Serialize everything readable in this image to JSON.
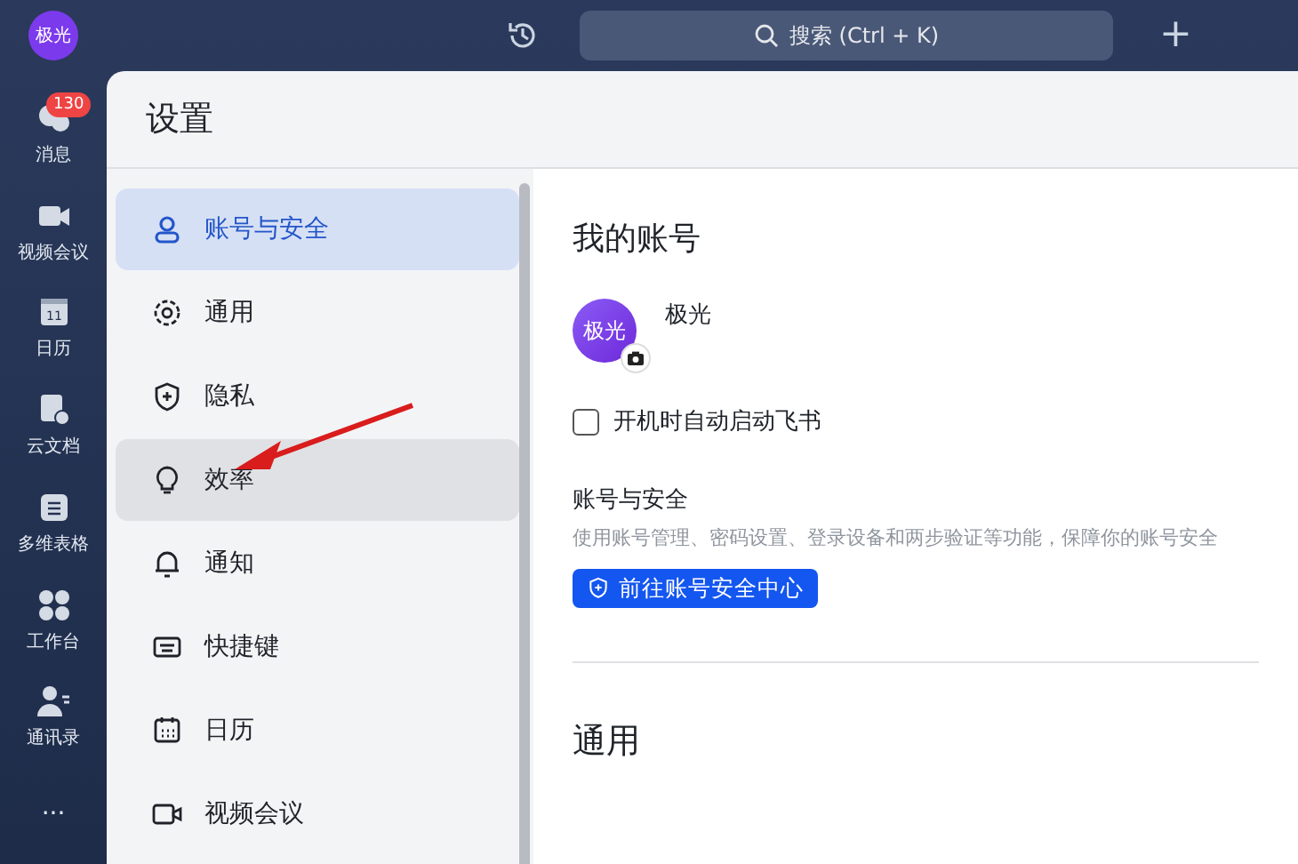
{
  "top_bar": {
    "avatar": "极光",
    "search_placeholder": "搜索 (Ctrl + K)",
    "add": "+"
  },
  "rail": [
    {
      "label": "消息",
      "badge": "130",
      "selected": false
    },
    {
      "label": "视频会议",
      "selected": false
    },
    {
      "label": "日历",
      "icon_text": "11",
      "selected": false
    },
    {
      "label": "云文档",
      "selected": false
    },
    {
      "label": "多维表格",
      "selected": false
    },
    {
      "label": "工作台",
      "selected": false
    },
    {
      "label": "通讯录",
      "selected": false
    },
    {
      "label": "···",
      "selected": false
    }
  ],
  "settings": {
    "title": "设置",
    "menu": [
      {
        "label": "账号与安全",
        "selected": true,
        "highlighted": false
      },
      {
        "label": "通用",
        "selected": false,
        "highlighted": false
      },
      {
        "label": "隐私",
        "selected": false,
        "highlighted": false
      },
      {
        "label": "效率",
        "selected": false,
        "highlighted": true
      },
      {
        "label": "通知",
        "selected": false,
        "highlighted": false
      },
      {
        "label": "快捷键",
        "selected": false,
        "highlighted": false
      },
      {
        "label": "日历",
        "selected": false,
        "highlighted": false
      },
      {
        "label": "视频会议",
        "selected": false,
        "highlighted": false
      }
    ],
    "content": {
      "heading": "我的账号",
      "avatar": "极光",
      "name": "极光",
      "autostart": {
        "label": "开机时自动启动飞书",
        "checked": false
      },
      "security_title": "账号与安全",
      "security_desc": "使用账号管理、密码设置、登录设备和两步验证等功能，保障你的账号安全",
      "security_button": "前往账号安全中心",
      "section2": "通用"
    }
  }
}
